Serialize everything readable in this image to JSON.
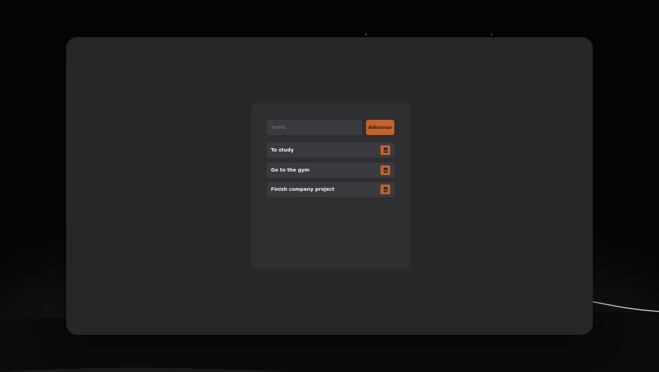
{
  "input": {
    "placeholder": "Tarefa",
    "value": ""
  },
  "add_button": {
    "label": "Adicionar"
  },
  "tasks": [
    {
      "label": "To study",
      "delete_icon": "trash-icon"
    },
    {
      "label": "Go to the gym",
      "delete_icon": "trash-icon"
    },
    {
      "label": "Finish company project",
      "delete_icon": "trash-icon"
    }
  ],
  "colors": {
    "accent": "#c4622d",
    "window_bg": "#27272a",
    "card_bg": "#2f2f32",
    "item_bg": "#3b3b3f"
  }
}
